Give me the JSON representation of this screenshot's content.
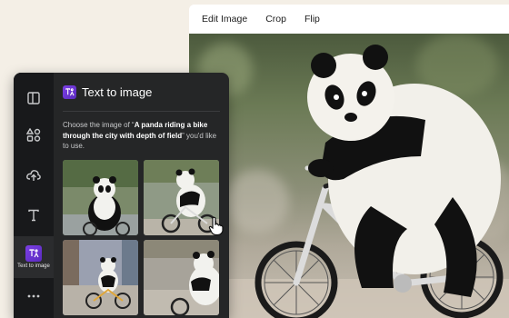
{
  "toolbar": {
    "edit_image": "Edit Image",
    "crop": "Crop",
    "flip": "Flip"
  },
  "sidebar": {
    "items": [
      {
        "icon": "layout-icon"
      },
      {
        "icon": "elements-icon"
      },
      {
        "icon": "upload-icon"
      },
      {
        "icon": "text-icon"
      },
      {
        "icon": "text-to-image-icon",
        "label": "Text to image"
      },
      {
        "icon": "more-icon"
      }
    ]
  },
  "panel": {
    "title": "Text to image",
    "prompt_pre": "Choose the image of “",
    "prompt_bold": "A panda riding a bike through the city with depth of field",
    "prompt_post": "” you'd like to use."
  },
  "results": [
    {
      "alt": "panda-result-1"
    },
    {
      "alt": "panda-result-2"
    },
    {
      "alt": "panda-result-3"
    },
    {
      "alt": "panda-result-4"
    }
  ],
  "colors": {
    "accent": "#7b3fe4",
    "panel_bg": "#252627",
    "rail_bg": "#18191b"
  }
}
